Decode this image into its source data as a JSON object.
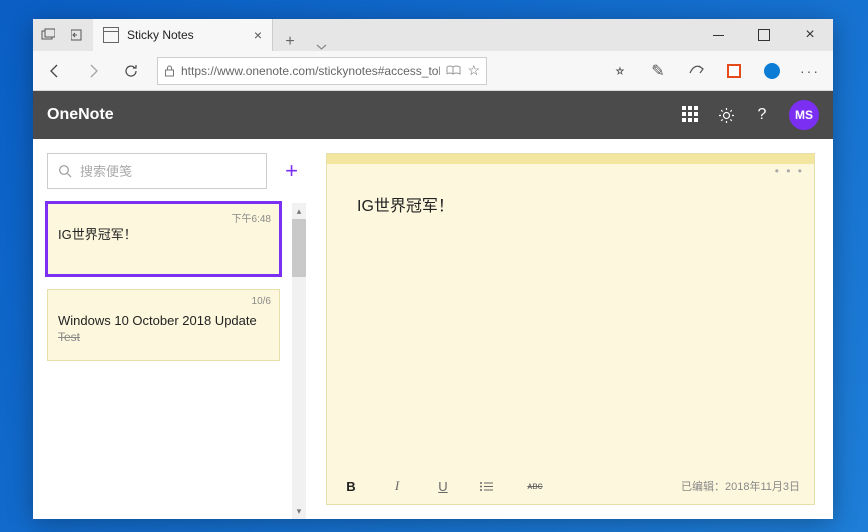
{
  "browser": {
    "tab_title": "Sticky Notes",
    "url": "https://www.onenote.com/stickynotes#access_toke"
  },
  "app": {
    "title": "OneNote",
    "avatar_initials": "MS"
  },
  "sidebar": {
    "search_placeholder": "搜索便笺",
    "notes": [
      {
        "time": "下午6:48",
        "title": "IG世界冠军！",
        "sub": "",
        "selected": true
      },
      {
        "time": "10/6",
        "title": "Windows 10 October 2018 Update",
        "sub": "Test",
        "selected": false
      }
    ]
  },
  "editor": {
    "title": "IG世界冠军！",
    "status": "已编辑：2018年11月3日",
    "toolbar": {
      "bold": "B",
      "italic": "I",
      "underline": "U",
      "list": "≔",
      "strike": "ᴀʙᴄ"
    }
  }
}
